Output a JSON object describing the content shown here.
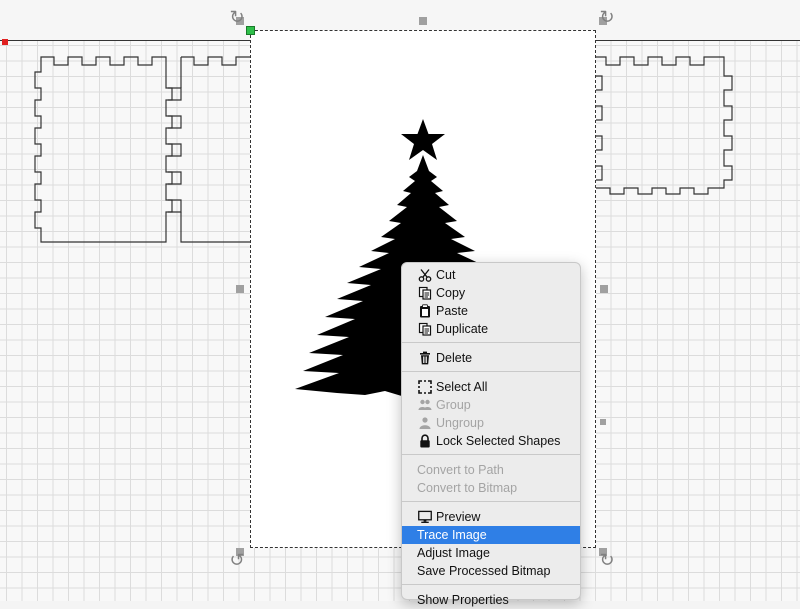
{
  "context_menu": {
    "items": {
      "cut": "Cut",
      "copy": "Copy",
      "paste": "Paste",
      "duplicate": "Duplicate",
      "delete": "Delete",
      "select_all": "Select All",
      "group": "Group",
      "ungroup": "Ungroup",
      "lock_selected_shapes": "Lock Selected Shapes",
      "convert_to_path": "Convert to Path",
      "convert_to_bitmap": "Convert to Bitmap",
      "preview": "Preview",
      "trace_image": "Trace Image",
      "adjust_image": "Adjust Image",
      "save_processed_bitmap": "Save Processed Bitmap",
      "show_properties": "Show Properties"
    },
    "highlighted_item": "Trace Image",
    "disabled_items": [
      "Group",
      "Ungroup",
      "Convert to Path",
      "Convert to Bitmap"
    ]
  },
  "colors": {
    "highlight": "#2f7fe6",
    "selection_handle_origin": "#2fbf4a",
    "origin_marker": "#e02020"
  },
  "icons": {
    "cut": "scissors-icon",
    "copy": "copy-icon",
    "paste": "clipboard-icon",
    "duplicate": "duplicate-icon",
    "delete": "trash-icon",
    "select_all": "select-all-icon",
    "group": "group-icon",
    "ungroup": "ungroup-icon",
    "lock": "lock-icon",
    "preview": "monitor-icon"
  }
}
